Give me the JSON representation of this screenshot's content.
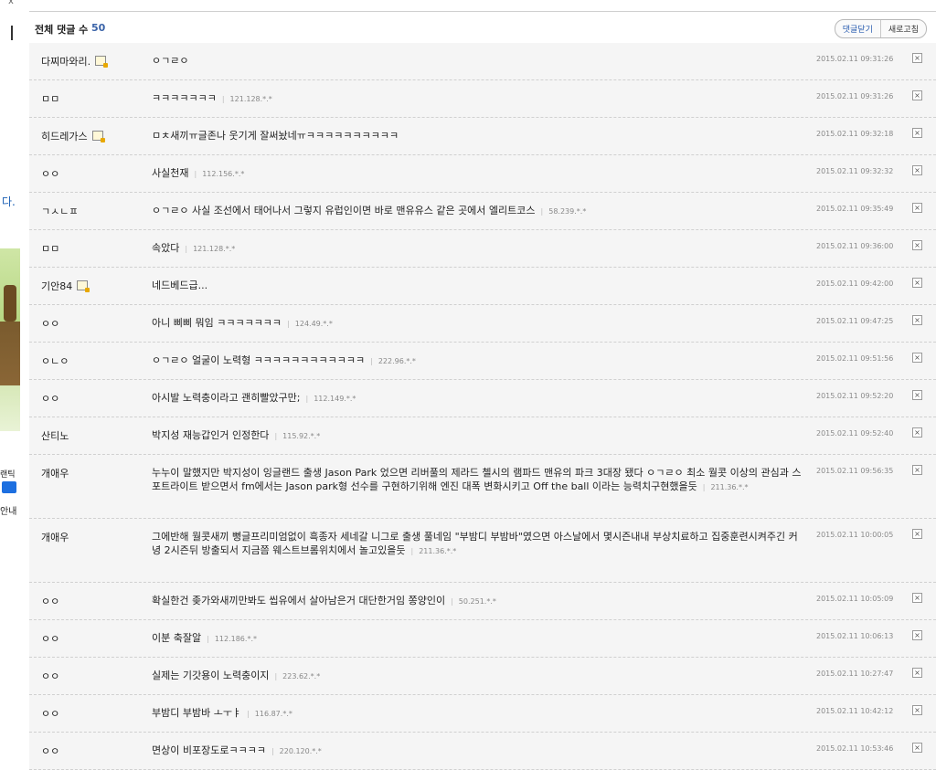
{
  "sidebar_fragment": {
    "close_glyph": "x",
    "text_da": "다.",
    "text_ticket": "랜틱",
    "text_guide": "안내"
  },
  "comments_header": {
    "label": "전체 댓글 수",
    "count": "50",
    "close_comments_button": "댓글닫기",
    "refresh_button": "새로고침"
  },
  "comments": [
    {
      "nick": "다찌마와리.",
      "badge": true,
      "text": "ㅇㄱㄹㅇ",
      "ip": "",
      "date": "2015.02.11 09:31:26"
    },
    {
      "nick": "ㅁㅁ",
      "badge": false,
      "text": "ㅋㅋㅋㅋㅋㅋㅋ",
      "ip": "121.128.*.*",
      "date": "2015.02.11 09:31:26"
    },
    {
      "nick": "히드레가스",
      "badge": true,
      "text": "ㅁㅊ새끼ㅠ글존나 웃기게 잘써놨네ㅠㅋㅋㅋㅋㅋㅋㅋㅋㅋㅋ",
      "ip": "",
      "date": "2015.02.11 09:32:18"
    },
    {
      "nick": "ㅇㅇ",
      "badge": false,
      "text": "사실천재",
      "ip": "112.156.*.*",
      "date": "2015.02.11 09:32:32"
    },
    {
      "nick": "ㄱㅅㄴㅍ",
      "badge": false,
      "text": "ㅇㄱㄹㅇ 사실 조선에서 태어나서 그렇지 유럽인이면 바로 맨유유스 같은 곳에서 엘리트코스",
      "ip": "58.239.*.*",
      "date": "2015.02.11 09:35:49"
    },
    {
      "nick": "ㅁㅁ",
      "badge": false,
      "text": "속았다",
      "ip": "121.128.*.*",
      "date": "2015.02.11 09:36:00"
    },
    {
      "nick": "기안84",
      "badge": true,
      "text": "네드베드급...",
      "ip": "",
      "date": "2015.02.11 09:42:00"
    },
    {
      "nick": "ㅇㅇ",
      "badge": false,
      "text": "아니 삐삐 뭐임 ㅋㅋㅋㅋㅋㅋㅋ",
      "ip": "124.49.*.*",
      "date": "2015.02.11 09:47:25"
    },
    {
      "nick": "ㅇㄴㅇ",
      "badge": false,
      "text": "ㅇㄱㄹㅇ 얼굴이 노력형 ㅋㅋㅋㅋㅋㅋㅋㅋㅋㅋㅋㅋ",
      "ip": "222.96.*.*",
      "date": "2015.02.11 09:51:56"
    },
    {
      "nick": "ㅇㅇ",
      "badge": false,
      "text": "아시발 노력충이라고 괜히빨았구만;",
      "ip": "112.149.*.*",
      "date": "2015.02.11 09:52:20"
    },
    {
      "nick": "산티노",
      "badge": false,
      "text": "박지성 재능갑인거 인정한다",
      "ip": "115.92.*.*",
      "date": "2015.02.11 09:52:40"
    },
    {
      "nick": "개애우",
      "badge": false,
      "text": "누누이 말했지만 박지성이 잉글랜드 출생 Jason Park 었으면 리버풀의 제라드 첼시의 램파드 맨유의 파크 3대장 됐다 ㅇㄱㄹㅇ 최소 월콧 이상의 관심과 스포트라이트 받으면서 fm에서는 Jason park형 선수를 구현하기위해 엔진 대폭 변화시키고 Off the ball 이라는 능력치구현했을듯",
      "ip": "211.36.*.*",
      "date": "2015.02.11 09:56:35",
      "tall": true
    },
    {
      "nick": "개애우",
      "badge": false,
      "text": "그에반해 월콧새끼 뻥글프리미엄없이 흑종자 세네갈 니그로 출생 풀네임 \"부밤디 부밤바\"였으면 아스날에서 몇시즌내내 부상치료하고 집중훈련시켜주긴 커녕 2시즌뒤 방출되서 지금쯤 웨스트브롬위치에서 놀고있을듯",
      "ip": "211.36.*.*",
      "date": "2015.02.11 10:00:05",
      "tall": true
    },
    {
      "nick": "ㅇㅇ",
      "badge": false,
      "text": "확실한건 좆가와새끼만봐도 씹유에서 살아남은거 대단한거임 쫑양인이",
      "ip": "50.251.*.*",
      "date": "2015.02.11 10:05:09"
    },
    {
      "nick": "ㅇㅇ",
      "badge": false,
      "text": "이분 축잘알",
      "ip": "112.186.*.*",
      "date": "2015.02.11 10:06:13"
    },
    {
      "nick": "ㅇㅇ",
      "badge": false,
      "text": "실제는 기갓용이 노력충이지",
      "ip": "223.62.*.*",
      "date": "2015.02.11 10:27:47"
    },
    {
      "nick": "ㅇㅇ",
      "badge": false,
      "text": "부밤디 부밤바 ㅗㅜㅑ",
      "ip": "116.87.*.*",
      "date": "2015.02.11 10:42:12"
    },
    {
      "nick": "ㅇㅇ",
      "badge": false,
      "text": "면상이 비포장도로ㅋㅋㅋㅋ",
      "ip": "220.120.*.*",
      "date": "2015.02.11 10:53:46"
    }
  ],
  "delete_glyph": "×"
}
